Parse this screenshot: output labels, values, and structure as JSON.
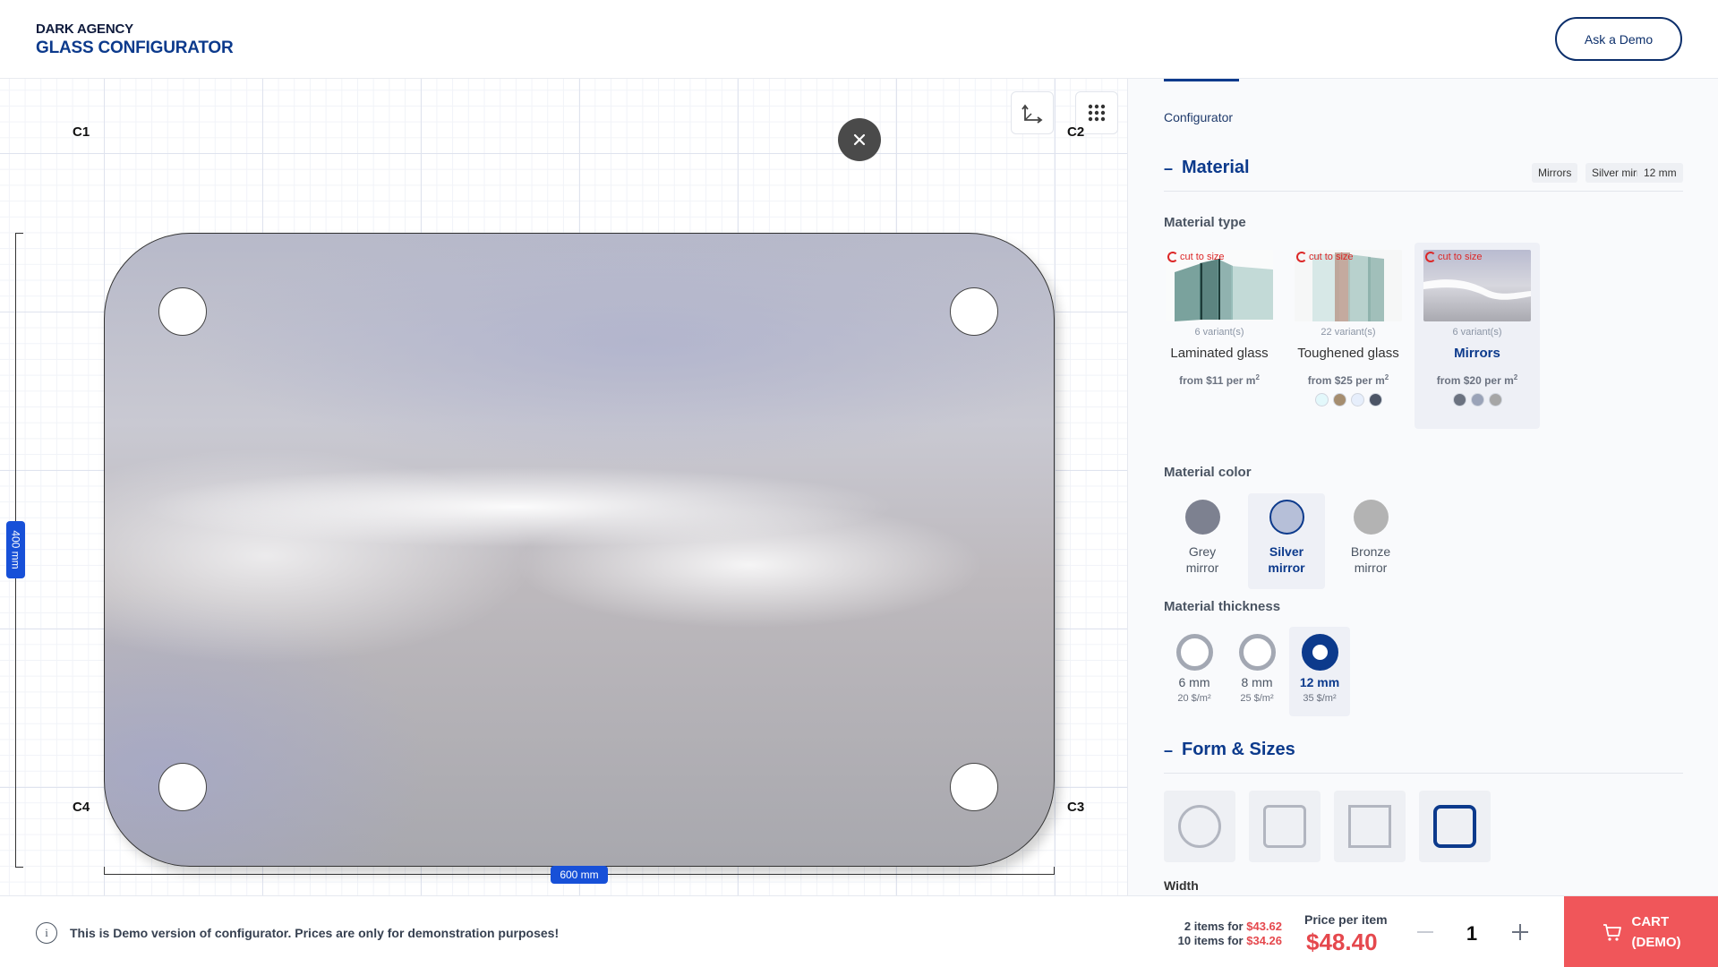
{
  "header": {
    "brand_line1": "DARK AGENCY",
    "brand_line2": "GLASS CONFIGURATOR",
    "demo_button": "Ask a Demo"
  },
  "canvas": {
    "corners": [
      "C1",
      "C2",
      "C3",
      "C4"
    ],
    "height_label": "400 mm",
    "width_label": "600 mm",
    "close_icon": "close-icon",
    "tools": [
      "axes-icon",
      "grid-icon"
    ]
  },
  "panel": {
    "tab_label": "Configurator",
    "material": {
      "title": "Material",
      "toggle": "–",
      "chips": [
        "Mirrors",
        "Silver mirror",
        "12 mm"
      ],
      "type_title": "Material type",
      "types": [
        {
          "badge": "cut to size",
          "variants": "6 variant(s)",
          "name": "Laminated glass",
          "price_prefix": "from $11 per m",
          "price_sup": "2",
          "dots": []
        },
        {
          "badge": "cut to size",
          "variants": "22 variant(s)",
          "name": "Toughened glass",
          "price_prefix": "from $25 per m",
          "price_sup": "2",
          "dots": [
            "#e3f8fb",
            "#a58d6f",
            "#e6eefb",
            "#4c5566"
          ]
        },
        {
          "badge": "cut to size",
          "variants": "6 variant(s)",
          "name": "Mirrors",
          "price_prefix": "from $20 per m",
          "price_sup": "2",
          "dots": [
            "#6b7280",
            "#9aa3b8",
            "#a6a6a6"
          ]
        }
      ],
      "selected_type": "Mirrors",
      "color_title": "Material color",
      "colors": [
        {
          "line1": "Grey",
          "line2": "mirror",
          "swatch": "#7d8190"
        },
        {
          "line1": "Silver",
          "line2": "mirror",
          "swatch": "#b6bfd8"
        },
        {
          "line1": "Bronze",
          "line2": "mirror",
          "swatch": "#b3b3b3"
        }
      ],
      "selected_color": "Silver mirror",
      "thickness_title": "Material thickness",
      "thicknesses": [
        {
          "label": "6 mm",
          "price": "20 $/m²"
        },
        {
          "label": "8 mm",
          "price": "25 $/m²"
        },
        {
          "label": "12 mm",
          "price": "35 $/m²"
        }
      ],
      "selected_thickness": "12 mm"
    },
    "form": {
      "title": "Form & Sizes",
      "toggle": "–",
      "shapes": [
        "circle-shape-icon",
        "rounded-rect-shape-icon",
        "rectangle-shape-icon",
        "rounded-corners-shape-icon"
      ],
      "selected_shape": "rounded-corners-shape-icon",
      "width_label": "Width"
    }
  },
  "footer": {
    "info_icon": "i",
    "info_text": "This is Demo version of configurator. Prices are only for demonstration purposes!",
    "bulk": [
      {
        "prefix": "2 items for",
        "price": "$43.62"
      },
      {
        "prefix": "10 items for",
        "price": "$34.26"
      }
    ],
    "price_label": "Price per item",
    "price_value": "$48.40",
    "quantity": "1",
    "cart_line1": "CART",
    "cart_line2": "(DEMO)"
  },
  "colors": {
    "brand_blue": "#0c3a8c",
    "accent_red": "#e5484d",
    "cart_red": "#f0565a",
    "dimension_blue": "#1750d8"
  }
}
